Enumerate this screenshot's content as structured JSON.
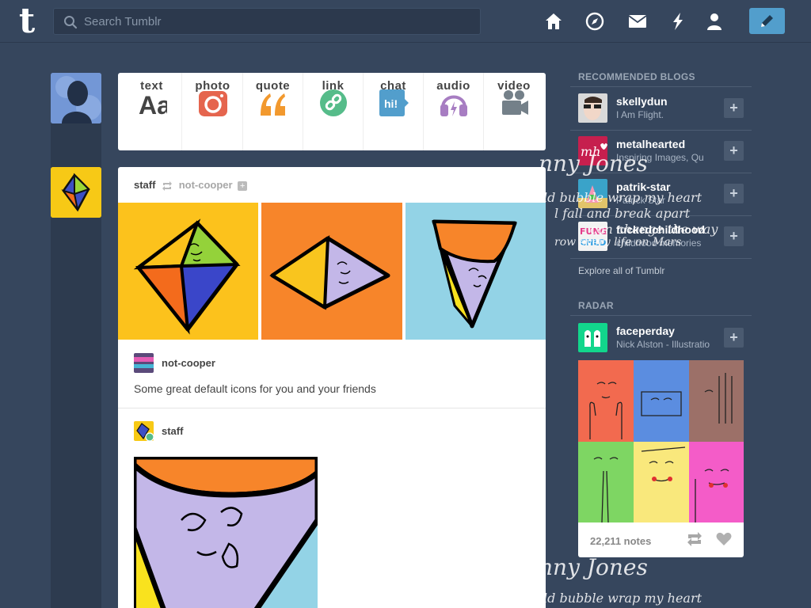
{
  "header": {
    "logo": "t",
    "search_placeholder": "Search Tumblr",
    "nav_icons": [
      "home-icon",
      "explore-compass-icon",
      "messages-envelope-icon",
      "activity-lightning-icon",
      "account-person-icon"
    ],
    "compose_icon": "pencil-icon",
    "colors": {
      "background": "#36465d",
      "compose": "#529ecc"
    }
  },
  "post_types": [
    {
      "label": "text",
      "icon": "text-aa-icon",
      "color": "#444444"
    },
    {
      "label": "photo",
      "icon": "camera-icon",
      "color": "#e5654e"
    },
    {
      "label": "quote",
      "icon": "quote-icon",
      "color": "#f2992e"
    },
    {
      "label": "link",
      "icon": "link-icon",
      "color": "#56bc8a"
    },
    {
      "label": "chat",
      "icon": "chat-bubble-icon",
      "color": "#529ecc"
    },
    {
      "label": "audio",
      "icon": "headphones-icon",
      "color": "#a77dc2"
    },
    {
      "label": "video",
      "icon": "video-camera-icon",
      "color": "#748089"
    }
  ],
  "post": {
    "author": "staff",
    "reblogged_from": "not-cooper",
    "reblog_author": "not-cooper",
    "caption": "Some great default icons for you and your friends",
    "second_author": "staff"
  },
  "sidebar": {
    "recommended_title": "RECOMMENDED BLOGS",
    "blogs": [
      {
        "name": "skellydun",
        "title": "I Am Flight."
      },
      {
        "name": "metalhearted",
        "title": "Inspiring Images, Qu"
      },
      {
        "name": "patrik-star",
        "title": "Patrick Star"
      },
      {
        "name": "fuckedchildhood",
        "title": "childhood memories"
      }
    ],
    "explore_link": "Explore all of Tumblr",
    "radar_title": "RADAR",
    "radar": {
      "name": "faceperday",
      "title": "Nick Alston - Illustratio",
      "notes": "22,211 notes"
    }
  },
  "overlay_text": {
    "line1": "nny Jones",
    "line2": "ld bubble wrap my heart",
    "line3": "l fall and break apart",
    "line4": "can change the way",
    "line5": "row every life on Mars",
    "line6": "nny Jones",
    "line7": "ld bubble wrap my heart"
  }
}
